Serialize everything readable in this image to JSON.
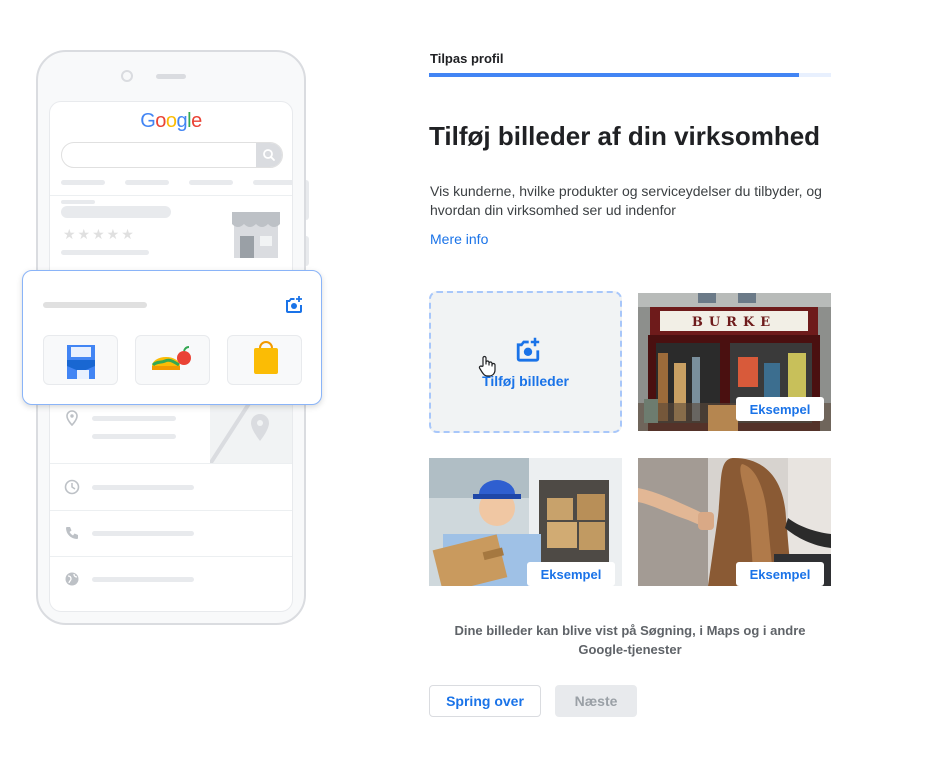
{
  "illustration": {
    "logo": [
      "G",
      "o",
      "o",
      "g",
      "l",
      "e"
    ],
    "stars": "★★★★★"
  },
  "header": {
    "step_label": "Tilpas profil",
    "progress_fraction": 0.92
  },
  "main": {
    "title": "Tilføj billeder af din virksomhed",
    "description": "Vis kunderne, hvilke produkter og serviceydelser du tilbyder, og hvordan din virksomhed ser ud indenfor",
    "more_link": "Mere info",
    "add_photos_label": "Tilføj billeder",
    "examples": [
      {
        "button_label": "Eksempel",
        "sign_text": "BURKE"
      },
      {
        "button_label": "Eksempel"
      },
      {
        "button_label": "Eksempel"
      }
    ],
    "note": "Dine billeder kan blive vist på Søgning, i Maps og i andre Google-tjenester"
  },
  "footer": {
    "skip_label": "Spring over",
    "next_label": "Næste"
  },
  "colors": {
    "accent": "#1a73e8",
    "progress": "#4285f4",
    "google_blue": "#4285f4",
    "google_red": "#ea4335",
    "google_yellow": "#fbbc05",
    "google_green": "#34a853"
  }
}
